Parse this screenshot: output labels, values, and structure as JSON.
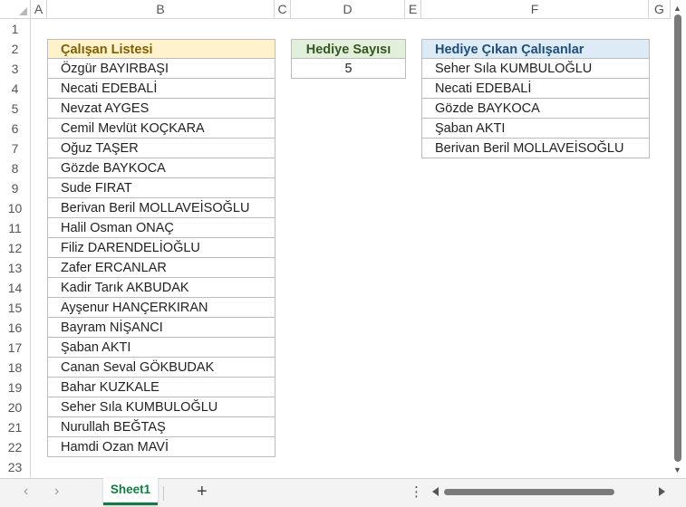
{
  "columns": [
    "A",
    "B",
    "C",
    "D",
    "E",
    "F",
    "G"
  ],
  "rows": [
    "1",
    "2",
    "3",
    "4",
    "5",
    "6",
    "7",
    "8",
    "9",
    "10",
    "11",
    "12",
    "13",
    "14",
    "15",
    "16",
    "17",
    "18",
    "19",
    "20",
    "21",
    "22",
    "23"
  ],
  "employee_list": {
    "header": "Çalışan Listesi",
    "names": [
      "Özgür BAYIRBAŞI",
      "Necati EDEBALİ",
      "Nevzat AYGES",
      "Cemil Mevlüt KOÇKARA",
      "Oğuz TAŞER",
      "Gözde BAYKOCA",
      "Sude FIRAT",
      "Berivan Beril MOLLAVEİSOĞLU",
      "Halil Osman ONAÇ",
      "Filiz DARENDELİOĞLU",
      "Zafer ERCANLAR",
      "Kadir Tarık AKBUDAK",
      "Ayşenur HANÇERKIRAN",
      "Bayram NİŞANCI",
      "Şaban AKTI",
      "Canan Seval GÖKBUDAK",
      "Bahar KUZKALE",
      "Seher Sıla KUMBULOĞLU",
      "Nurullah BEĞTAŞ",
      "Hamdi Ozan MAVİ"
    ]
  },
  "gift_count": {
    "header": "Hediye Sayısı",
    "value": "5"
  },
  "gift_winners": {
    "header": "Hediye Çıkan Çalışanlar",
    "names": [
      "Seher Sıla KUMBULOĞLU",
      "Necati EDEBALİ",
      "Gözde BAYKOCA",
      "Şaban AKTI",
      "Berivan Beril MOLLAVEİSOĞLU"
    ]
  },
  "tabs": {
    "active_sheet": "Sheet1",
    "add_label": "+"
  },
  "icons": {
    "prev_sheet": "chevron-left-icon",
    "next_sheet": "chevron-right-icon",
    "more": "more-vertical-icon"
  },
  "colors": {
    "accent": "#107c41",
    "header_yellow": "#fff2cc",
    "header_green": "#e2efda",
    "header_blue": "#ddebf7"
  }
}
